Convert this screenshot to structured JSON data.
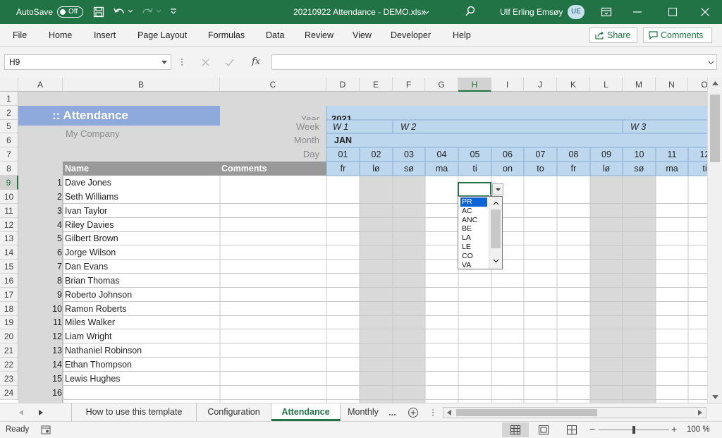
{
  "titlebar": {
    "autosave_label": "AutoSave",
    "autosave_state": "Off",
    "filename": "20210922 Attendance - DEMO.xlsx",
    "user_name": "Ulf Erling Emsøy",
    "user_initials": "UE"
  },
  "menu": {
    "items": [
      "File",
      "Home",
      "Insert",
      "Page Layout",
      "Formulas",
      "Data",
      "Review",
      "View",
      "Developer",
      "Help"
    ],
    "share_label": "Share",
    "comments_label": "Comments"
  },
  "formula_bar": {
    "name_box": "H9",
    "fx_label": "fx",
    "value": ""
  },
  "columns": [
    "A",
    "B",
    "C",
    "D",
    "E",
    "F",
    "G",
    "H",
    "I",
    "J",
    "K",
    "L",
    "M",
    "N",
    "O"
  ],
  "selected_column": "H",
  "row_numbers": [
    "1",
    "2",
    "5",
    "6",
    "7",
    "8",
    "9",
    "10",
    "11",
    "12",
    "13",
    "14",
    "15",
    "16",
    "17",
    "18",
    "19",
    "20",
    "21",
    "22",
    "23",
    "24"
  ],
  "selected_row": "9",
  "header": {
    "title": ":: Attendance",
    "company": "My Company",
    "year_label": "Year",
    "year_value": "2021",
    "week_label": "Week",
    "weeks": [
      "W 1",
      "W 2",
      "W 3"
    ],
    "month_label": "Month",
    "month_value": "JAN",
    "day_label": "Day",
    "days": [
      "01",
      "02",
      "03",
      "04",
      "05",
      "06",
      "07",
      "08",
      "09",
      "10",
      "11",
      "12"
    ],
    "weekdays": [
      "fr",
      "lø",
      "sø",
      "ma",
      "ti",
      "on",
      "to",
      "fr",
      "lø",
      "sø",
      "ma",
      "ti"
    ],
    "name_header": "Name",
    "comments_header": "Comments"
  },
  "employees": [
    {
      "no": "1",
      "name": "Dave Jones"
    },
    {
      "no": "2",
      "name": "Seth Williams"
    },
    {
      "no": "3",
      "name": "Ivan Taylor"
    },
    {
      "no": "4",
      "name": "Riley Davies"
    },
    {
      "no": "5",
      "name": "Gilbert Brown"
    },
    {
      "no": "6",
      "name": "Jorge Wilson"
    },
    {
      "no": "7",
      "name": "Dan Evans"
    },
    {
      "no": "8",
      "name": "Brian Thomas"
    },
    {
      "no": "9",
      "name": "Roberto Johnson"
    },
    {
      "no": "10",
      "name": "Ramon Roberts"
    },
    {
      "no": "11",
      "name": "Miles Walker"
    },
    {
      "no": "12",
      "name": "Liam Wright"
    },
    {
      "no": "13",
      "name": "Nathaniel Robinson"
    },
    {
      "no": "14",
      "name": "Ethan Thompson"
    },
    {
      "no": "15",
      "name": "Lewis Hughes"
    },
    {
      "no": "16",
      "name": ""
    }
  ],
  "dropdown": {
    "options": [
      "PR",
      "AC",
      "ANC",
      "BE",
      "LA",
      "LE",
      "CO",
      "VA"
    ],
    "highlighted": "PR"
  },
  "sheet_tabs": {
    "tabs": [
      "How to use this template",
      "Configuration",
      "Attendance",
      "Monthly"
    ],
    "active": "Attendance",
    "more": "..."
  },
  "status": {
    "ready": "Ready",
    "zoom": "100 %",
    "zoom_level_percent": 100
  },
  "colors": {
    "excel_green": "#217346",
    "title_fill": "#8ea9db",
    "calendar_fill": "#bdd7ee",
    "header_gray": "#999999",
    "weekend_fill": "#d9d9d9",
    "side_gray": "#d9d9d9"
  },
  "icons": [
    "save-icon",
    "undo-icon",
    "redo-icon",
    "search-icon",
    "share-icon",
    "comments-icon",
    "fx-icon",
    "dropdown-arrow-icon",
    "add-sheet-icon",
    "normal-view-icon",
    "page-layout-view-icon",
    "page-break-view-icon",
    "macro-record-icon"
  ]
}
